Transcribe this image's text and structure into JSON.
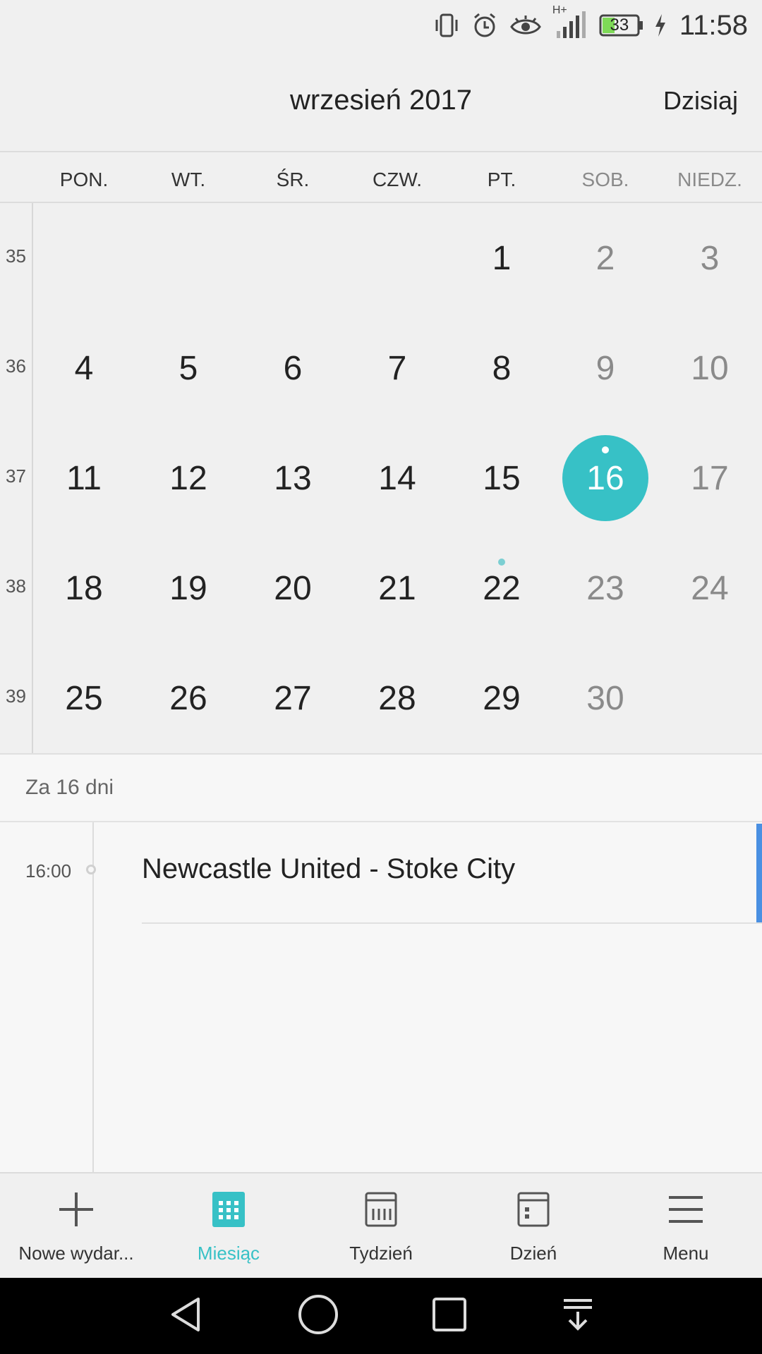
{
  "status_bar": {
    "time": "11:58",
    "battery": "33",
    "network": "H+",
    "icons": [
      "vibrate-icon",
      "alarm-icon",
      "eye-comfort-icon",
      "signal-icon",
      "battery-icon",
      "charging-icon"
    ]
  },
  "header": {
    "title": "wrzesień 2017",
    "today_button": "Dzisiaj"
  },
  "weekdays": [
    "PON.",
    "WT.",
    "ŚR.",
    "CZW.",
    "PT.",
    "SOB.",
    "NIEDZ."
  ],
  "weeks": [
    {
      "number": "35",
      "days": [
        "",
        "",
        "",
        "",
        "1",
        "2",
        "3"
      ]
    },
    {
      "number": "36",
      "days": [
        "4",
        "5",
        "6",
        "7",
        "8",
        "9",
        "10"
      ]
    },
    {
      "number": "37",
      "days": [
        "11",
        "12",
        "13",
        "14",
        "15",
        "16",
        "17"
      ]
    },
    {
      "number": "38",
      "days": [
        "18",
        "19",
        "20",
        "21",
        "22",
        "23",
        "24"
      ]
    },
    {
      "number": "39",
      "days": [
        "25",
        "26",
        "27",
        "28",
        "29",
        "30",
        ""
      ]
    }
  ],
  "selected_day": "16",
  "event_dot_days": [
    "22"
  ],
  "agenda": {
    "header": "Za 16 dni",
    "events": [
      {
        "time": "16:00",
        "title": "Newcastle United - Stoke City"
      }
    ]
  },
  "bottom_nav": [
    {
      "label": "Nowe wydar...",
      "icon": "plus-icon"
    },
    {
      "label": "Miesiąc",
      "icon": "month-grid-icon",
      "active": true
    },
    {
      "label": "Tydzień",
      "icon": "week-calendar-icon"
    },
    {
      "label": "Dzień",
      "icon": "day-calendar-icon"
    },
    {
      "label": "Menu",
      "icon": "menu-icon"
    }
  ],
  "colors": {
    "accent": "#37c1c6",
    "event_accent": "#4a90e2",
    "background": "#f0f0f0"
  }
}
